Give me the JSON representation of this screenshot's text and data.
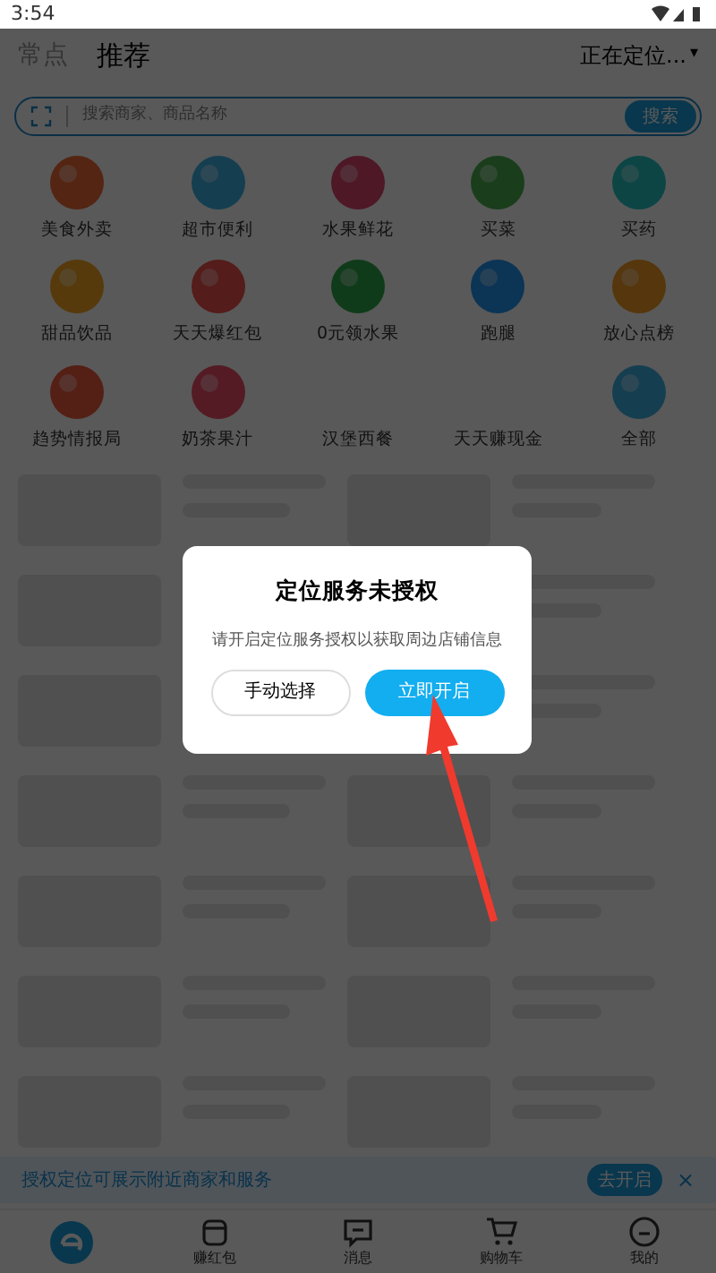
{
  "status_bar": {
    "time": "3:54"
  },
  "header": {
    "tabs": [
      {
        "label": "常点",
        "selected": false
      },
      {
        "label": "推荐",
        "selected": true
      }
    ],
    "location": "正在定位...",
    "location_caret": "▾"
  },
  "search": {
    "placeholder": "搜索商家、商品名称",
    "button": "搜索"
  },
  "categories": [
    {
      "label": "美食外卖",
      "icon": true
    },
    {
      "label": "超市便利",
      "icon": true
    },
    {
      "label": "水果鲜花",
      "icon": true
    },
    {
      "label": "买菜",
      "icon": true
    },
    {
      "label": "买药",
      "icon": true
    },
    {
      "label": "甜品饮品",
      "icon": true
    },
    {
      "label": "天天爆红包",
      "icon": true
    },
    {
      "label": "0元领水果",
      "icon": true
    },
    {
      "label": "跑腿",
      "icon": true
    },
    {
      "label": "放心点榜",
      "icon": true
    },
    {
      "label": "趋势情报局",
      "icon": true
    },
    {
      "label": "奶茶果汁",
      "icon": true
    },
    {
      "label": "汉堡西餐",
      "icon": false
    },
    {
      "label": "天天赚现金",
      "icon": false
    },
    {
      "label": "全部",
      "icon": true
    }
  ],
  "dialog": {
    "title": "定位服务未授权",
    "message": "请开启定位服务授权以获取周边店铺信息",
    "buttons": [
      {
        "label": "手动选择",
        "kind": "secondary"
      },
      {
        "label": "立即开启",
        "kind": "primary"
      }
    ]
  },
  "banner": {
    "text": "授权定位可展示附近商家和服务",
    "button": "去开启",
    "close": "×"
  },
  "bottom_nav": [
    {
      "kind": "home",
      "selected": true
    },
    {
      "label": "赚红包",
      "kind": "bag",
      "selected": false
    },
    {
      "label": "消息",
      "kind": "chat",
      "selected": false
    },
    {
      "label": "购物车",
      "kind": "cart",
      "selected": false
    },
    {
      "label": "我的",
      "kind": "face",
      "selected": false
    }
  ]
}
